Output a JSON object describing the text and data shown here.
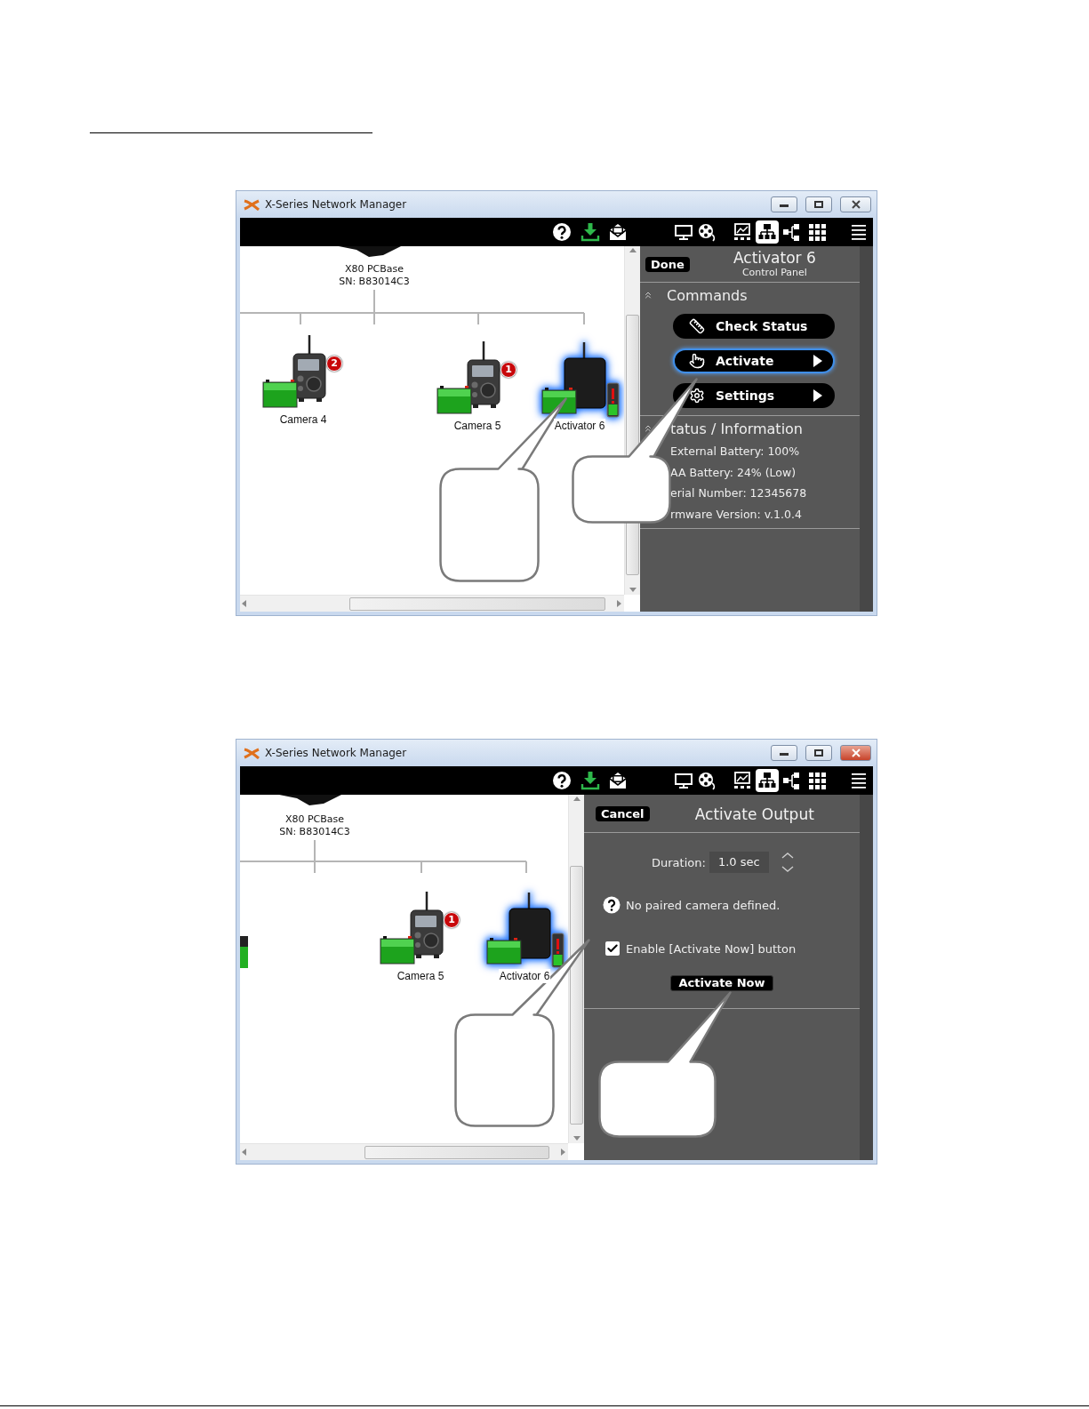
{
  "screenshots": [
    {
      "window": {
        "title": "X-Series Network Manager",
        "active": false
      },
      "toolbar": [
        {
          "kind": "help",
          "selected": false
        },
        {
          "kind": "download",
          "selected": false
        },
        {
          "kind": "mail",
          "selected": false
        },
        {
          "kind": "monitor",
          "selected": false
        },
        {
          "kind": "film",
          "selected": false
        },
        {
          "kind": "chart",
          "selected": false
        },
        {
          "kind": "network",
          "selected": true
        },
        {
          "kind": "tree",
          "selected": false
        },
        {
          "kind": "grid",
          "selected": false
        },
        {
          "kind": "menu",
          "selected": false
        }
      ],
      "network": {
        "base": {
          "name": "X80 PCBase",
          "serial": "SN: B83014C3"
        },
        "devices": [
          {
            "kind": "camera",
            "name": "Camera 4",
            "badge": "2",
            "selected": false
          },
          {
            "kind": "camera",
            "name": "Camera 5",
            "badge": "1",
            "selected": false
          },
          {
            "kind": "activator",
            "name": "Activator 6",
            "selected": true
          }
        ]
      },
      "panel": {
        "kind": "control_panel",
        "back_button": "Done",
        "title": "Activator 6",
        "subtitle": "Control Panel",
        "sections": [
          {
            "kind": "commands",
            "title": "Commands",
            "expanded": true,
            "buttons": [
              {
                "kind": "check",
                "label": "Check Status",
                "submenu": false,
                "focused": false
              },
              {
                "kind": "activate",
                "label": "Activate",
                "submenu": true,
                "focused": true
              },
              {
                "kind": "settings",
                "label": "Settings",
                "submenu": true,
                "focused": false
              }
            ]
          },
          {
            "kind": "info",
            "title": "tatus / Information",
            "expanded": true,
            "lines": [
              "External Battery:  100%",
              "AA Battery:  24%  (Low)",
              "erial Number: 12345678",
              "rmware Version: v.1.0.4"
            ]
          }
        ]
      }
    },
    {
      "window": {
        "title": "X-Series Network Manager",
        "active": true
      },
      "toolbar": [
        {
          "kind": "help",
          "selected": false
        },
        {
          "kind": "download",
          "selected": false
        },
        {
          "kind": "mail",
          "selected": false
        },
        {
          "kind": "monitor",
          "selected": false
        },
        {
          "kind": "film",
          "selected": false
        },
        {
          "kind": "chart",
          "selected": false
        },
        {
          "kind": "network",
          "selected": true
        },
        {
          "kind": "tree",
          "selected": false
        },
        {
          "kind": "grid",
          "selected": false
        },
        {
          "kind": "menu",
          "selected": false
        }
      ],
      "network": {
        "base": {
          "name": "X80 PCBase",
          "serial": "SN: B83014C3"
        },
        "devices": [
          {
            "kind": "camera",
            "name": "Camera 5",
            "badge": "1",
            "selected": false
          },
          {
            "kind": "activator",
            "name": "Activator 6",
            "selected": true
          }
        ]
      },
      "panel": {
        "kind": "activate_output",
        "back_button": "Cancel",
        "title": "Activate Output",
        "duration": {
          "label": "Duration:",
          "value": "1.0 sec"
        },
        "note": "No paired camera defined.",
        "enable": {
          "label": "Enable [Activate Now] button",
          "checked": true
        },
        "action_button": "Activate Now"
      }
    }
  ]
}
